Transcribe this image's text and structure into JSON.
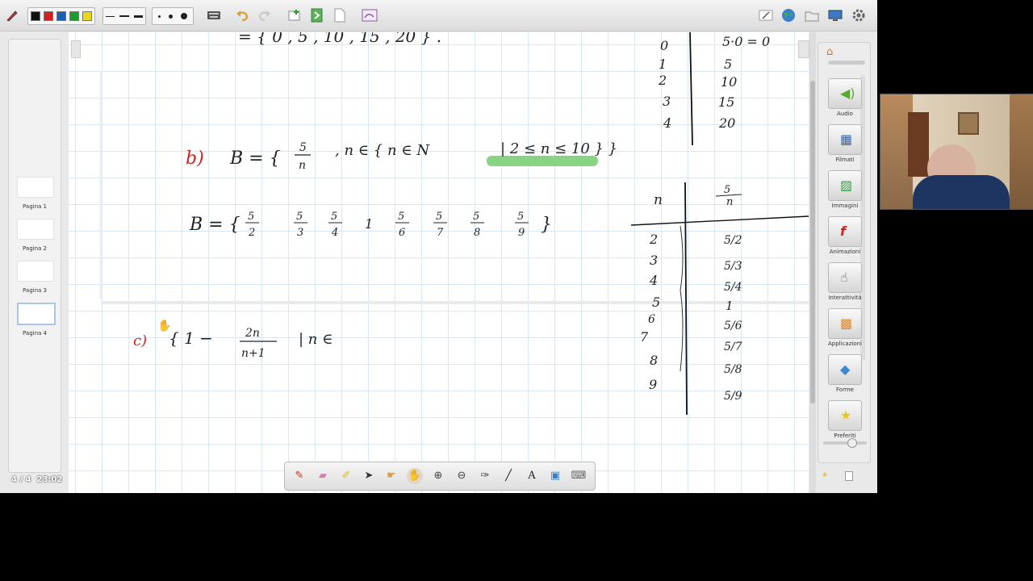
{
  "status": {
    "page_counter": "4 / 4",
    "time": "23:02"
  },
  "pages": [
    {
      "label": "Pagina 1"
    },
    {
      "label": "Pagina 2"
    },
    {
      "label": "Pagina 3"
    },
    {
      "label": "Pagina 4"
    }
  ],
  "gallery": {
    "items": [
      {
        "label": "Audio",
        "icon": "speaker-icon"
      },
      {
        "label": "Filmati",
        "icon": "film-icon"
      },
      {
        "label": "Immagini",
        "icon": "image-icon"
      },
      {
        "label": "Animazioni",
        "icon": "flash-icon"
      },
      {
        "label": "Interattività",
        "icon": "hand-cursor-icon"
      },
      {
        "label": "Applicazioni",
        "icon": "apps-icon"
      },
      {
        "label": "Forme",
        "icon": "shapes-icon"
      },
      {
        "label": "Preferiti",
        "icon": "star-icon"
      }
    ]
  },
  "toolbar": {
    "colors": [
      "#111111",
      "#d42020",
      "#1c5fb8",
      "#1c9d2b",
      "#e8d81c"
    ]
  },
  "board": {
    "top_line": "= { 0 , 5 , 10 , 15 , 20 } .",
    "part_b_label": "b)",
    "b_def_lhs": "B = {",
    "b_def_frac_num": "5",
    "b_def_frac_den": "n",
    "b_def_rhs": ",   n ∈ { n ∈ N",
    "b_condition": "| 2 ≤ n ≤ 10 } }",
    "b_set_lhs": "B = {",
    "b_set_fracs": [
      {
        "num": "5",
        "den": "2"
      },
      {
        "num": "5",
        "den": "3"
      },
      {
        "num": "5",
        "den": "4"
      },
      {
        "whole": "1"
      },
      {
        "num": "5",
        "den": "6"
      },
      {
        "num": "5",
        "den": "7"
      },
      {
        "num": "5",
        "den": "8"
      },
      {
        "num": "5",
        "den": "9"
      }
    ],
    "b_set_rhs": "}",
    "part_c_label": "c)",
    "c_lhs": "{ 1 −",
    "c_frac_num": "2n",
    "c_frac_den": "n+1",
    "c_rhs": "| n ∈",
    "table1": {
      "rows": [
        {
          "n": "0",
          "v": "5·0 = 0"
        },
        {
          "n": "1",
          "v": "5"
        },
        {
          "n": "2",
          "v": "10"
        },
        {
          "n": "3",
          "v": "15"
        },
        {
          "n": "4",
          "v": "20"
        }
      ]
    },
    "table2": {
      "header_n": "n",
      "header_v_num": "5",
      "header_v_den": "n",
      "rows": [
        {
          "n": "2",
          "v": "5/2"
        },
        {
          "n": "3",
          "v": "5/3"
        },
        {
          "n": "4",
          "v": "5/4"
        },
        {
          "n": "5",
          "v": "1"
        },
        {
          "n": "6",
          "v": "5/6"
        },
        {
          "n": "7",
          "v": "5/7"
        },
        {
          "n": "8",
          "v": "5/8"
        },
        {
          "n": "9",
          "v": "5/9"
        }
      ]
    }
  }
}
